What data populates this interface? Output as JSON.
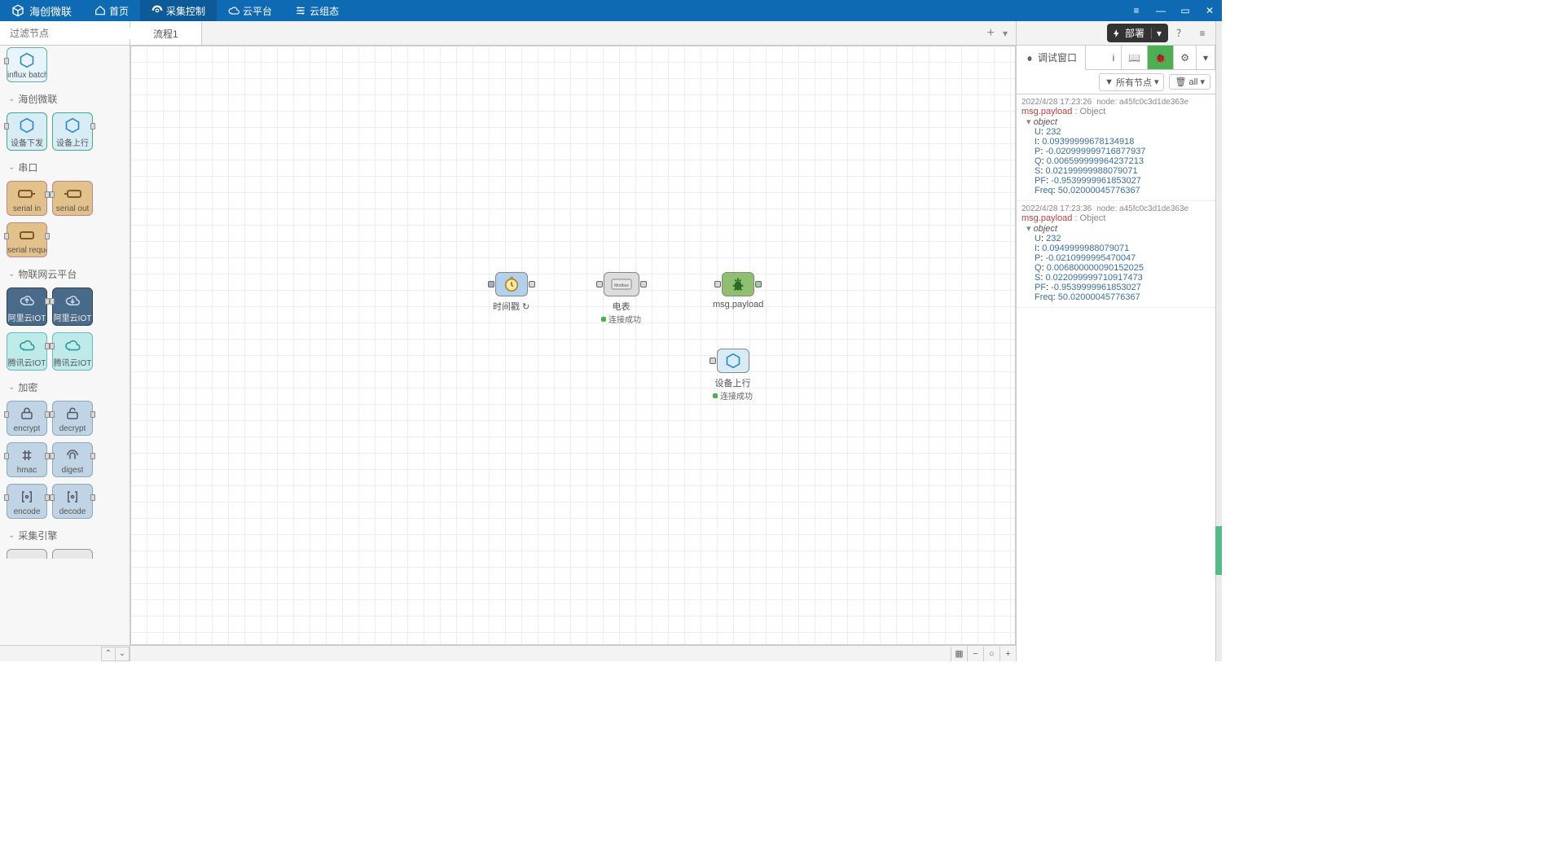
{
  "app": {
    "title": "海创微联"
  },
  "nav": {
    "home": "首页",
    "collect": "采集控制",
    "cloud": "云平台",
    "scada": "云组态"
  },
  "palette": {
    "search_placeholder": "过滤节点",
    "tile_influx": "influx batch",
    "cat_hcwl": "海创微联",
    "tile_dev_down": "设备下发",
    "tile_dev_up": "设备上行",
    "cat_serial": "串口",
    "tile_serial_in": "serial in",
    "tile_serial_out": "serial out",
    "tile_serial_req": "serial reque",
    "cat_iotcloud": "物联网云平台",
    "tile_ali1": "阿里云IOT",
    "tile_ali2": "阿里云IOT",
    "tile_tx1": "腾讯云IOT",
    "tile_tx2": "腾讯云IOT",
    "cat_encrypt": "加密",
    "tile_encrypt": "encrypt",
    "tile_decrypt": "decrypt",
    "tile_hmac": "hmac",
    "tile_digest": "digest",
    "tile_encode": "encode",
    "tile_decode": "decode",
    "cat_engine": "采集引擎"
  },
  "workspace": {
    "tab1": "流程1",
    "node_timer": "时间戳 ↻",
    "node_meter": "电表",
    "node_meter_status": "连接成功",
    "node_debug": "msg.payload",
    "node_uplink": "设备上行",
    "node_uplink_status": "连接成功"
  },
  "rsb": {
    "deploy": "部署",
    "tab_debug": "调试窗口",
    "filter_all_nodes": "所有节点",
    "filter_all": "all"
  },
  "debug": [
    {
      "ts": "2022/4/28 17:23:26",
      "node": "node: a45fc0c3d1de363e",
      "mp_label": "msg.payload",
      "mp_type": "Object",
      "obj_label": "object",
      "kv": [
        {
          "k": "U",
          "v": "232"
        },
        {
          "k": "I",
          "v": "0.09399999678134918"
        },
        {
          "k": "P",
          "v": "-0.020999999716877937"
        },
        {
          "k": "Q",
          "v": "0.006599999964237213"
        },
        {
          "k": "S",
          "v": "0.02199999988079071"
        },
        {
          "k": "PF",
          "v": "-0.9539999961853027"
        },
        {
          "k": "Freq",
          "v": "50.02000045776367"
        }
      ]
    },
    {
      "ts": "2022/4/28 17:23:36",
      "node": "node: a45fc0c3d1de363e",
      "mp_label": "msg.payload",
      "mp_type": "Object",
      "obj_label": "object",
      "kv": [
        {
          "k": "U",
          "v": "232"
        },
        {
          "k": "I",
          "v": "0.0949999988079071"
        },
        {
          "k": "P",
          "v": "-0.0210999995470047"
        },
        {
          "k": "Q",
          "v": "0.006800000090152025"
        },
        {
          "k": "S",
          "v": "0.022099999710917473"
        },
        {
          "k": "PF",
          "v": "-0.9539999961853027"
        },
        {
          "k": "Freq",
          "v": "50.02000045776367"
        }
      ]
    }
  ]
}
